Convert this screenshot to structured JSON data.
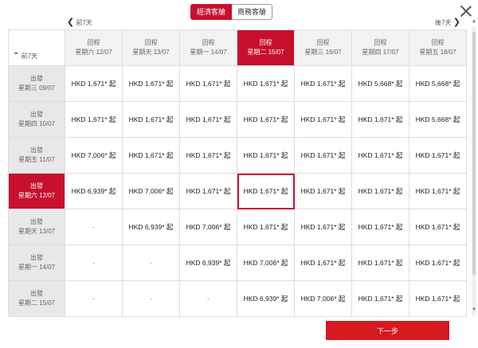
{
  "cabin": {
    "economy": "經濟客艙",
    "business": "商務客艙"
  },
  "nav": {
    "prev_label": "前7天",
    "next_label": "後7天",
    "earlier_label": "前7天",
    "prev_glyph": "❮",
    "next_glyph": "❯",
    "earlier_glyph": "⌃"
  },
  "return_label": "回程",
  "depart_label": "出發",
  "return_dates": [
    "星期六 12/07",
    "星期天 13/07",
    "星期一 14/07",
    "星期二 15/07",
    "星期三 16/07",
    "星期四 17/07",
    "星期五 18/07"
  ],
  "depart_dates": [
    "星期三 09/07",
    "星期四 10/07",
    "星期五 11/07",
    "星期六 12/07",
    "星期天 13/07",
    "星期一 14/07",
    "星期二 15/07"
  ],
  "selected_return_index": 3,
  "selected_depart_index": 3,
  "prices": [
    [
      "HKD 1,671* 起",
      "HKD 1,671* 起",
      "HKD 1,671* 起",
      "HKD 1,671* 起",
      "HKD 1,671* 起",
      "HKD 5,668* 起",
      "HKD 5,668* 起"
    ],
    [
      "HKD 1,671* 起",
      "HKD 1,671* 起",
      "HKD 1,671* 起",
      "HKD 1,671* 起",
      "HKD 1,671* 起",
      "HKD 1,671* 起",
      "HKD 5,668* 起"
    ],
    [
      "HKD 7,006* 起",
      "HKD 1,671* 起",
      "HKD 1,671* 起",
      "HKD 1,671* 起",
      "HKD 1,671* 起",
      "HKD 1,671* 起",
      "HKD 1,671* 起"
    ],
    [
      "HKD 6,939* 起",
      "HKD 7,006* 起",
      "HKD 1,671* 起",
      "HKD 1,671* 起",
      "HKD 1,671* 起",
      "HKD 1,671* 起",
      "HKD 1,671* 起"
    ],
    [
      "-",
      "HKD 6,939* 起",
      "HKD 7,006* 起",
      "HKD 1,671* 起",
      "HKD 1,671* 起",
      "HKD 1,671* 起",
      "HKD 1,671* 起"
    ],
    [
      "-",
      "-",
      "HKD 6,939* 起",
      "HKD 7,006* 起",
      "HKD 1,671* 起",
      "HKD 1,671* 起",
      "HKD 1,671* 起"
    ],
    [
      "-",
      "-",
      "-",
      "HKD 6,939* 起",
      "HKD 7,006* 起",
      "HKD 1,671* 起",
      "HKD 1,671* 起"
    ]
  ],
  "next_button": "下一步",
  "colors": {
    "accent": "#c8102e",
    "button": "#d71920"
  }
}
